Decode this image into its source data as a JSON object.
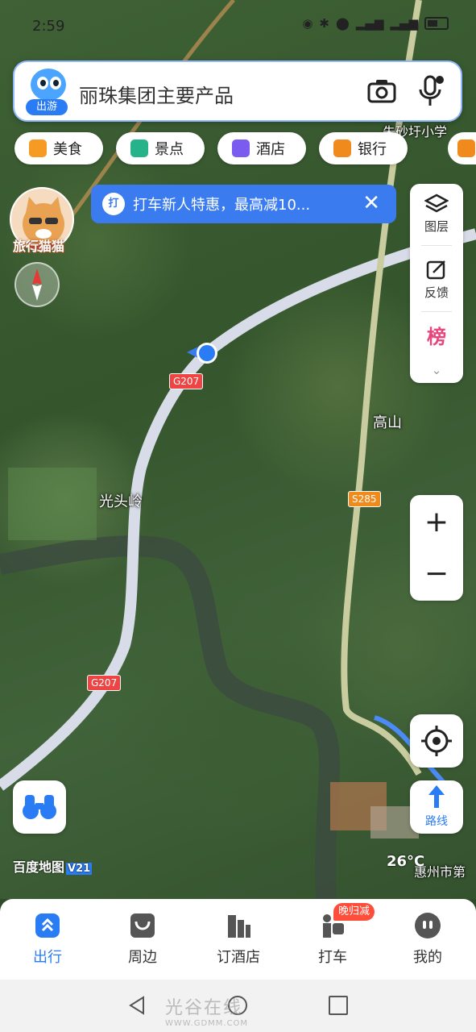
{
  "status_bar": {
    "time": "2:59"
  },
  "search": {
    "logo_tag": "出游",
    "query": "丽珠集团主要产品"
  },
  "chips": [
    {
      "label": "美食",
      "color": "#f59a23"
    },
    {
      "label": "景点",
      "color": "#27b38a"
    },
    {
      "label": "酒店",
      "color": "#7a5cf0"
    },
    {
      "label": "银行",
      "color": "#f08a1c"
    }
  ],
  "promo": {
    "icon_text": "打",
    "text": "打车新人特惠，最高减10..."
  },
  "avatar": {
    "label": "旅行猫猫"
  },
  "right_panel": {
    "layers": "图层",
    "feedback": "反馈",
    "rank": "榜"
  },
  "map": {
    "labels": {
      "gaoshan": "高山",
      "guangtouling": "光头岭",
      "top_right": "朱砂圩小学",
      "bottom_right": "惠州市第"
    },
    "road_tags": {
      "g207_top": "G207",
      "g207_bottom": "G207",
      "s285": "S285"
    },
    "brand": "百度地图",
    "version": "V21",
    "weather": "26°C"
  },
  "zoom": {
    "plus": "+",
    "minus": "−"
  },
  "route": {
    "label": "路线"
  },
  "tabs": [
    {
      "label": "出行",
      "active": true
    },
    {
      "label": "周边"
    },
    {
      "label": "订酒店"
    },
    {
      "label": "打车"
    },
    {
      "label": "我的"
    }
  ],
  "taxi_badge": "晚归减",
  "watermark": {
    "main": "光谷在线",
    "sub": "WWW.GDMM.COM"
  },
  "colors": {
    "accent": "#2a7cf4",
    "road": "#d8dce8"
  }
}
